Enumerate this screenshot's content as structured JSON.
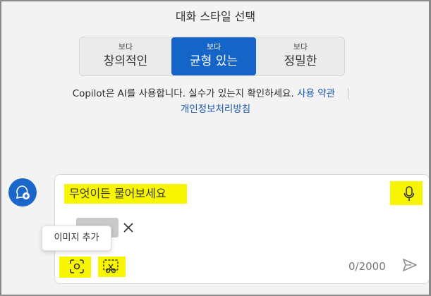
{
  "header": {
    "title": "대화 스타일 선택"
  },
  "tones": [
    {
      "small": "보다",
      "big": "창의적인"
    },
    {
      "small": "보다",
      "big": "균형 있는"
    },
    {
      "small": "보다",
      "big": "정밀한"
    }
  ],
  "notice": {
    "text": "Copilot은 AI를 사용합니다. 실수가 있는지 확인하세요.",
    "terms": "사용 약관",
    "privacy": "개인정보처리방침"
  },
  "composer": {
    "placeholder": "무엇이든 물어보세요",
    "counter": "0/2000",
    "tooltip": "이미지 추가"
  },
  "colors": {
    "accent": "#1565c8",
    "highlight": "#f7f600"
  },
  "icons": [
    "new-topic-icon",
    "microphone-icon",
    "close-icon",
    "image-capture-icon",
    "screenshot-icon",
    "send-icon"
  ]
}
